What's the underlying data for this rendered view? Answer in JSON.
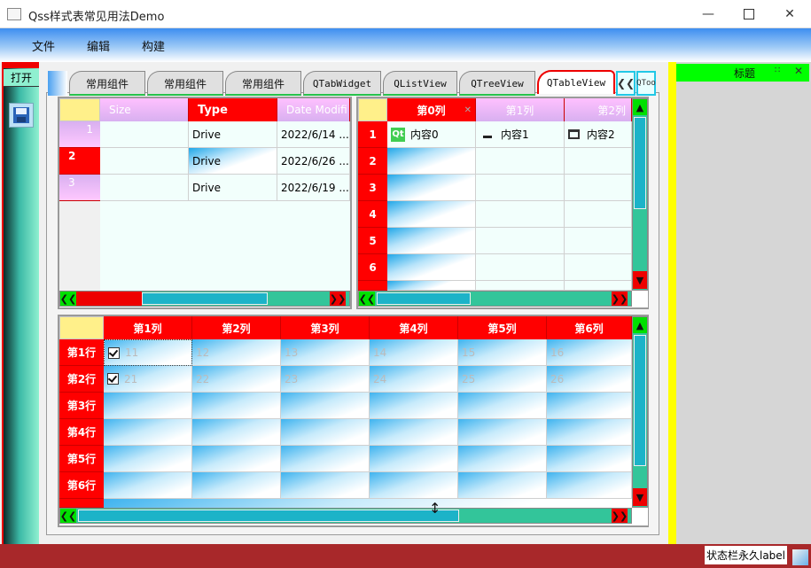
{
  "window": {
    "title": "Qss样式表常见用法Demo"
  },
  "menubar": {
    "items": [
      "文件",
      "编辑",
      "构建"
    ]
  },
  "toolbar": {
    "open_label": "打开"
  },
  "tabs": {
    "items": [
      "常用组件",
      "常用组件",
      "常用组件",
      "QTabWidget",
      "QListView",
      "QTreeView",
      "QTableView"
    ],
    "overflow_label": "QToo"
  },
  "fs_table": {
    "headers": [
      "Size",
      "Type",
      "Date Modifi"
    ],
    "row_labels": [
      "1",
      "2",
      "3"
    ],
    "rows": [
      [
        "",
        "Drive",
        "2022/6/14 ..."
      ],
      [
        "",
        "Drive",
        "2022/6/26 ..."
      ],
      [
        "",
        "Drive",
        "2022/6/19 ..."
      ]
    ]
  },
  "right_table": {
    "headers": [
      "第0列",
      "第1列",
      "第2列"
    ],
    "row_labels": [
      "1",
      "2",
      "3",
      "4",
      "5",
      "6"
    ],
    "first_row": [
      "内容0",
      "内容1",
      "内容2"
    ]
  },
  "bottom_table": {
    "headers": [
      "第1列",
      "第2列",
      "第3列",
      "第4列",
      "第5列",
      "第6列"
    ],
    "row_labels": [
      "第1行",
      "第2行",
      "第3行",
      "第4行",
      "第5行",
      "第6行"
    ],
    "rows": [
      [
        "11",
        "12",
        "13",
        "14",
        "15",
        "16"
      ],
      [
        "21",
        "22",
        "23",
        "24",
        "25",
        "26"
      ]
    ]
  },
  "dock": {
    "title": "标题"
  },
  "status": {
    "permanent_label": "状态栏永久label"
  },
  "colors": {
    "header_red": "#ff0000",
    "scroll_green": "#33c59a",
    "thumb_teal": "#1cb3c8",
    "dock_title": "#00ff00",
    "status_bar": "#a8282a"
  }
}
